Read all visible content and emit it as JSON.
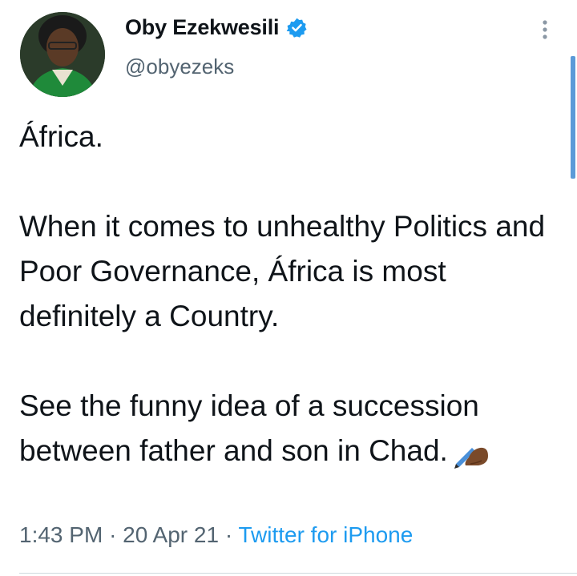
{
  "author": {
    "name": "Oby Ezekwesili",
    "handle": "@obyezeks",
    "verified": true
  },
  "tweet": {
    "paragraphs": [
      "África.",
      "When it comes to unhealthy Politics and Poor Governance, África is most definitely a Country.",
      "See the funny idea of a succession between father and son in Chad."
    ],
    "emoji": "writing-hand-emoji"
  },
  "meta": {
    "time": "1:43 PM",
    "separator": "·",
    "date": "20 Apr 21",
    "source": "Twitter for iPhone"
  },
  "colors": {
    "verified": "#1d9bf0",
    "link": "#1d9bf0",
    "muted": "#536471",
    "scrollbar": "#5b9ad8"
  }
}
